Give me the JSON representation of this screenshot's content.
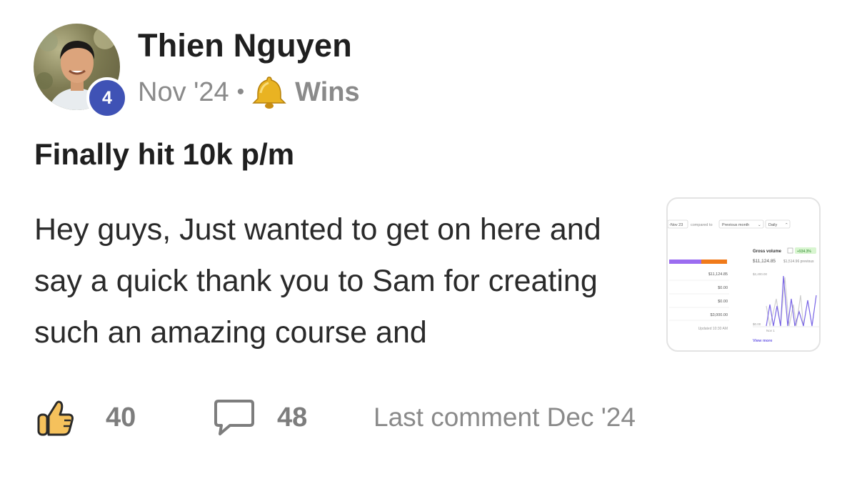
{
  "post": {
    "author": "Thien Nguyen",
    "level": "4",
    "date": "Nov '24",
    "separator": "•",
    "category": "Wins",
    "category_icon": "bell-icon",
    "title": "Finally hit 10k p/m",
    "body": "Hey guys, Just wanted to get on here and say a quick thank you to Sam for creating such an amazing course and"
  },
  "thumbnail": {
    "date_range": "-Nov 23",
    "compared_to": "compared to",
    "compare_option": "Previous month",
    "interval": "Daily",
    "gross_volume_label": "Gross volume",
    "gross_volume_change": "+934.3%",
    "gross_volume": "$11,124.85",
    "previous_value": "$1,514.96 previous",
    "y_top": "$2,400.00",
    "y_bottom": "$0.00",
    "x_label": "Nov 1",
    "values": [
      "$11,124.85",
      "$0.00",
      "$0.00",
      "$3,000.00"
    ],
    "updated": "Updated 10:30 AM",
    "view_more": "View more"
  },
  "footer": {
    "likes": "40",
    "comments": "48",
    "last_comment": "Last comment Dec '24"
  },
  "colors": {
    "badge": "#3f52b5",
    "like_icon": "#f5c15c",
    "bar_purple": "#9b6cf0",
    "bar_orange": "#f07a1a",
    "change_green": "#d8f5d0"
  }
}
